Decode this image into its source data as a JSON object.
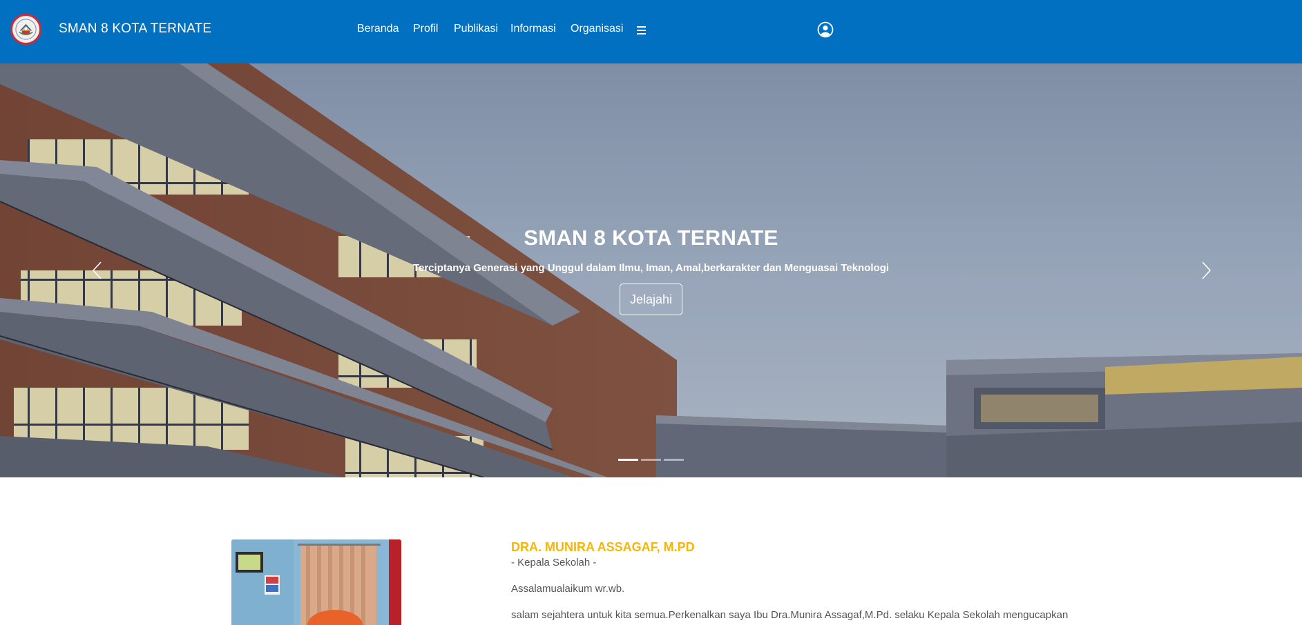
{
  "brand": {
    "name": "SMAN 8 KOTA TERNATE",
    "logo_icon": "school-emblem-icon"
  },
  "nav": {
    "items": [
      {
        "label": "Beranda"
      },
      {
        "label": "Profil"
      },
      {
        "label": "Publikasi"
      },
      {
        "label": "Informasi"
      },
      {
        "label": "Organisasi"
      }
    ],
    "menu_icon": "hamburger-menu-icon",
    "account_icon": "user-circle-icon"
  },
  "hero": {
    "title": "SMAN 8 KOTA TERNATE",
    "subtitle": "Terciptanya Generasi yang Unggul dalam Ilmu, Iman, Amal,berkarakter dan Menguasai Teknologi",
    "button_label": "Jelajahi",
    "prev_icon": "chevron-left-icon",
    "next_icon": "chevron-right-icon",
    "slide_count": 3,
    "active_slide": 1
  },
  "principal": {
    "name": "DRA. MUNIRA ASSAGAF, M.PD",
    "role": "- Kepala Sekolah -",
    "greeting": "Assalamualaikum wr.wb.",
    "intro": "salam sejahtera untuk kita semua.Perkenalkan saya Ibu Dra.Munira Assagaf,M.Pd. selaku Kepala Sekolah mengucapkan"
  },
  "colors": {
    "navbar": "#0270c1",
    "accent": "#f5b50a",
    "body_text": "#555555"
  }
}
